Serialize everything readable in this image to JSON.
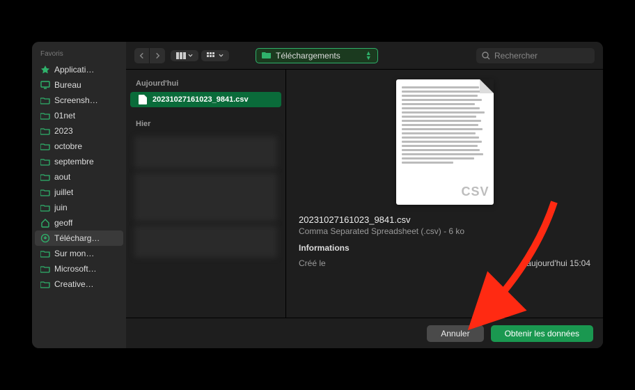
{
  "sidebar": {
    "header": "Favoris",
    "items": [
      {
        "icon": "app",
        "label": "Applicati…"
      },
      {
        "icon": "desktop",
        "label": "Bureau"
      },
      {
        "icon": "folder",
        "label": "Screensh…"
      },
      {
        "icon": "folder",
        "label": "01net"
      },
      {
        "icon": "folder",
        "label": "2023"
      },
      {
        "icon": "folder",
        "label": "octobre"
      },
      {
        "icon": "folder",
        "label": "septembre"
      },
      {
        "icon": "folder",
        "label": "aout"
      },
      {
        "icon": "folder",
        "label": "juillet"
      },
      {
        "icon": "folder",
        "label": "juin"
      },
      {
        "icon": "home",
        "label": "geoff"
      },
      {
        "icon": "downloads",
        "label": "Télécharg…",
        "selected": true
      },
      {
        "icon": "folder",
        "label": "Sur mon…"
      },
      {
        "icon": "folder",
        "label": "Microsoft…"
      },
      {
        "icon": "folder",
        "label": "Creative…"
      }
    ]
  },
  "toolbar": {
    "path_label": "Téléchargements",
    "search_placeholder": "Rechercher"
  },
  "list": {
    "section_today": "Aujourd'hui",
    "section_yesterday": "Hier",
    "files_today": [
      {
        "name": "20231027161023_9841.csv",
        "selected": true
      }
    ]
  },
  "preview": {
    "watermark": "CSV",
    "filename": "20231027161023_9841.csv",
    "meta": "Comma Separated Spreadsheet (.csv) - 6 ko",
    "info_header": "Informations",
    "rows": [
      {
        "label": "Créé le",
        "value": "aujourd'hui 15:04"
      }
    ]
  },
  "footer": {
    "cancel": "Annuler",
    "confirm": "Obtenir les données"
  }
}
